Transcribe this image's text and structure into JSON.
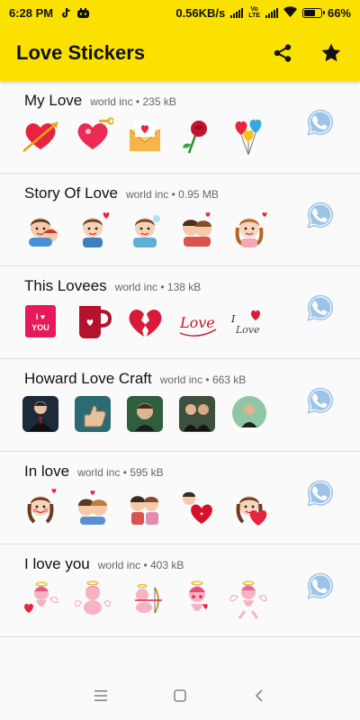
{
  "status_bar": {
    "time": "6:28 PM",
    "network_speed": "0.56KB/s",
    "volte_top": "Vo",
    "volte_bottom": "LTE",
    "battery_percent": "66%",
    "battery_level": 0.66
  },
  "app_bar": {
    "title": "Love Stickers",
    "icons": [
      "share-icon",
      "star-icon"
    ]
  },
  "packs": [
    {
      "name": "My Love",
      "meta": "world inc • 235 kB",
      "stickers": [
        "heart-arrow",
        "heart-key",
        "love-letter",
        "rose",
        "heart-balloons"
      ]
    },
    {
      "name": "Story Of Love",
      "meta": "world inc • 0.95 MB",
      "stickers": [
        "couple-hug",
        "boy-heart",
        "boy-thinking",
        "couple-cheek",
        "girl-hearts"
      ]
    },
    {
      "name": "This Lovees",
      "meta": "world inc • 138 kB",
      "stickers": [
        "i-love-you-card",
        "love-mug",
        "broken-heart",
        "love-script",
        "love-script-2"
      ]
    },
    {
      "name": "Howard Love Craft",
      "meta": "world inc • 663 kB",
      "stickers": [
        "man-suit",
        "thumbs-up",
        "man-head",
        "two-men",
        "man-portrait"
      ]
    },
    {
      "name": "In love",
      "meta": "world inc • 595 kB",
      "stickers": [
        "girl-blush",
        "couple-hearts",
        "couple-kiss",
        "couple-heart-sign",
        "girl-heart"
      ]
    },
    {
      "name": "I love you",
      "meta": "world inc • 403 kB",
      "stickers": [
        "cupid-heart",
        "cupid-sitting",
        "cupid-bow",
        "cupid-blush",
        "cupid-dancing"
      ]
    }
  ],
  "add_to_whatsapp_icon": "whatsapp-icon",
  "nav_bar": {
    "icons": [
      "recents-icon",
      "home-icon",
      "back-icon"
    ]
  },
  "colors": {
    "app_bar": "#fae100",
    "whatsapp_blue": "#9ec3e9",
    "heart_red": "#e8233f"
  }
}
